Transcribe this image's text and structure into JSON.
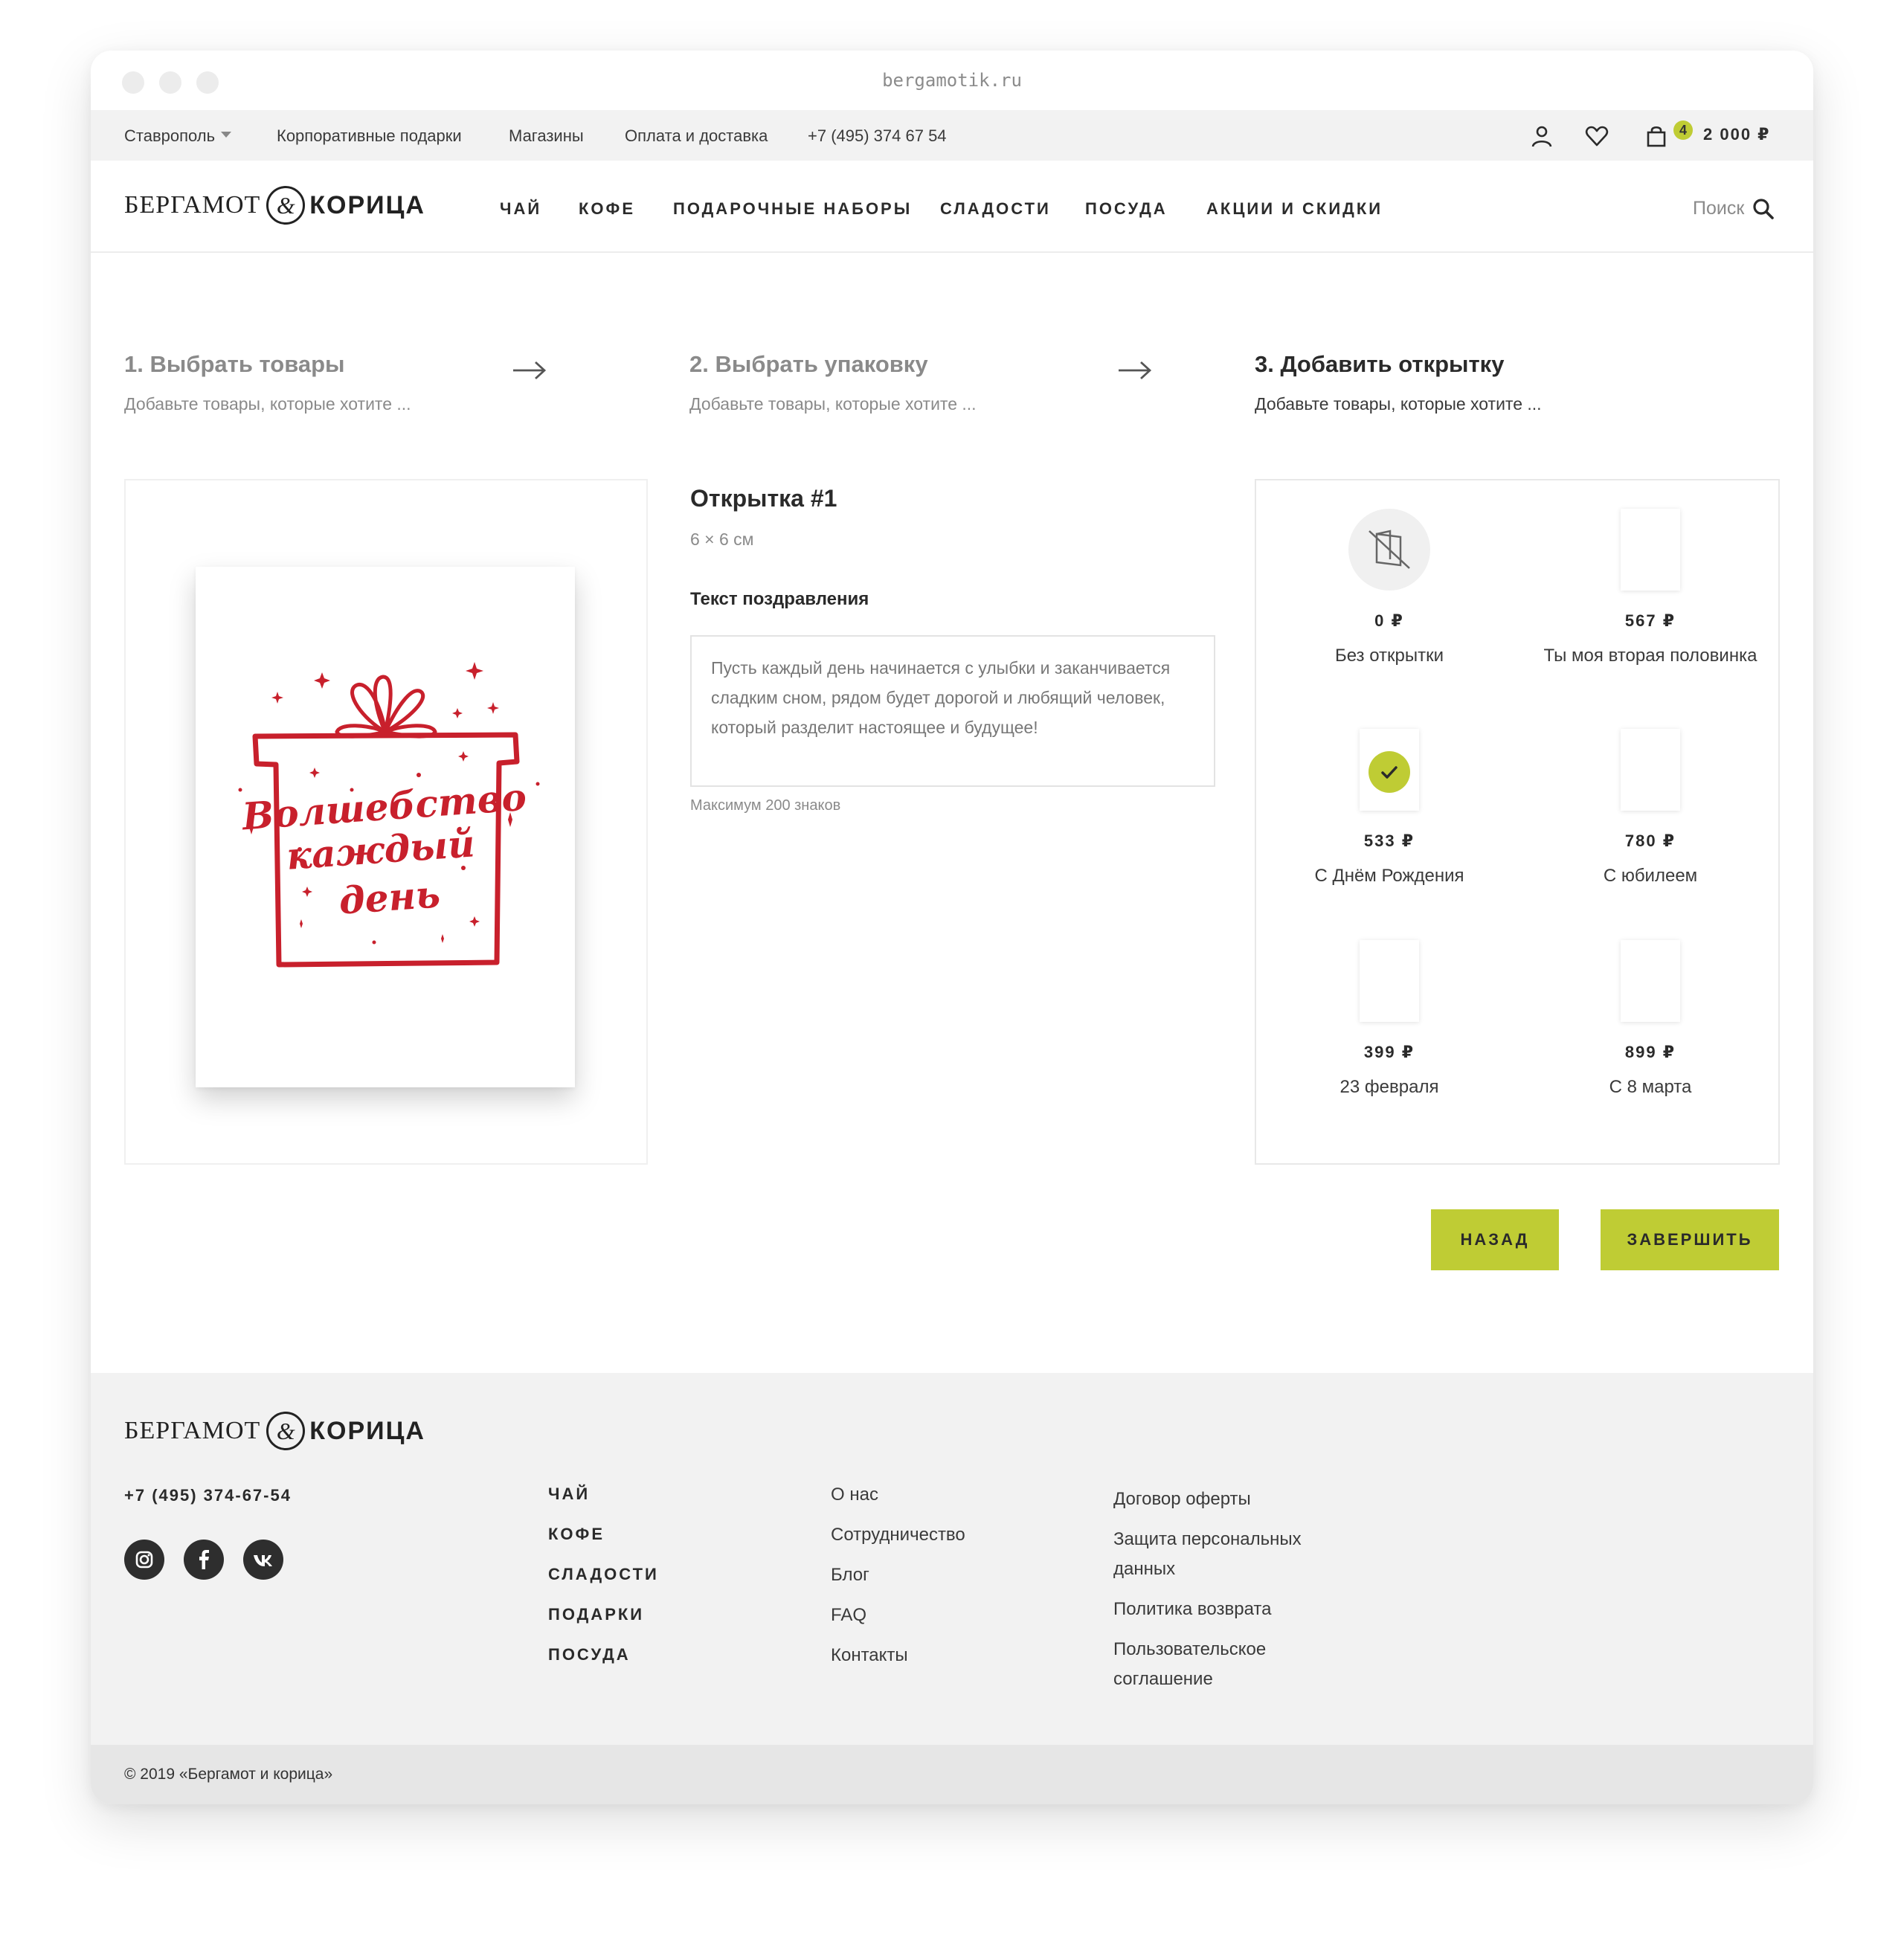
{
  "browser": {
    "url": "bergamotik.ru"
  },
  "topbar": {
    "city": "Ставрополь",
    "links": [
      "Корпоративные подарки",
      "Магазины",
      "Оплата и доставка"
    ],
    "phone": "+7 (495) 374 67 54",
    "icons": [
      "user-icon",
      "heart-icon",
      "cart-icon"
    ],
    "cart_count": "4",
    "cart_total": "2 000 ₽"
  },
  "header": {
    "logo": {
      "word1": "БЕРГАМОТ",
      "amp": "&",
      "word2": "КОРИЦА"
    },
    "nav": [
      "ЧАЙ",
      "КОФЕ",
      "ПОДАРОЧНЫЕ НАБОРЫ",
      "СЛАДОСТИ",
      "ПОСУДА",
      "АКЦИИ И СКИДКИ"
    ],
    "search_label": "Поиск"
  },
  "steps": [
    {
      "title": "1. Выбрать товары",
      "desc": "Добавьте товары, которые хотите ...",
      "active": false
    },
    {
      "title": "2. Выбрать упаковку",
      "desc": "Добавьте товары, которые хотите ...",
      "active": false
    },
    {
      "title": "3. Добавить открытку",
      "desc": "Добавьте товары, которые хотите ...",
      "active": true
    }
  ],
  "card_preview": {
    "lettering": "Волшебство каждый день"
  },
  "details": {
    "title": "Открытка #1",
    "size": "6 × 6 см",
    "text_label": "Текст поздравления",
    "text_value": "Пусть каждый день начинается с улыбки и заканчивается сладким сном, рядом будет дорогой и любящий человек, который разделит настоящее и будущее!",
    "hint": "Максимум 200 знаков"
  },
  "options": [
    {
      "price": "0 ₽",
      "name": "Без открытки",
      "icon": "no-card-icon",
      "selected": false
    },
    {
      "price": "567 ₽",
      "name": "Ты моя вторая половинка",
      "selected": false
    },
    {
      "price": "533 ₽",
      "name": "С Днём Рождения",
      "selected": true
    },
    {
      "price": "780 ₽",
      "name": "С юбилеем",
      "selected": false
    },
    {
      "price": "399 ₽",
      "name": "23 февраля",
      "selected": false
    },
    {
      "price": "899 ₽",
      "name": "С 8 марта",
      "selected": false
    }
  ],
  "buttons": {
    "back": "НАЗАД",
    "finish": "ЗАВЕРШИТЬ"
  },
  "footer": {
    "phone": "+7 (495) 374-67-54",
    "social": [
      "instagram-icon",
      "facebook-icon",
      "vk-icon"
    ],
    "col1": [
      "ЧАЙ",
      "КОФЕ",
      "СЛАДОСТИ",
      "ПОДАРКИ",
      "ПОСУДА"
    ],
    "col2": [
      "О нас",
      "Сотрудничество",
      "Блог",
      "FAQ",
      "Контакты"
    ],
    "col3": [
      "Договор оферты",
      "Защита персональных данных",
      "Политика возврата",
      "Пользовательское соглашение"
    ],
    "copyright": "© 2019 «Бергамот и корица»"
  },
  "colors": {
    "accent": "#bfcc34",
    "card_red": "#c8202c",
    "topbar_bg": "#f2f2f2",
    "footer_bg": "#f2f2f2"
  }
}
